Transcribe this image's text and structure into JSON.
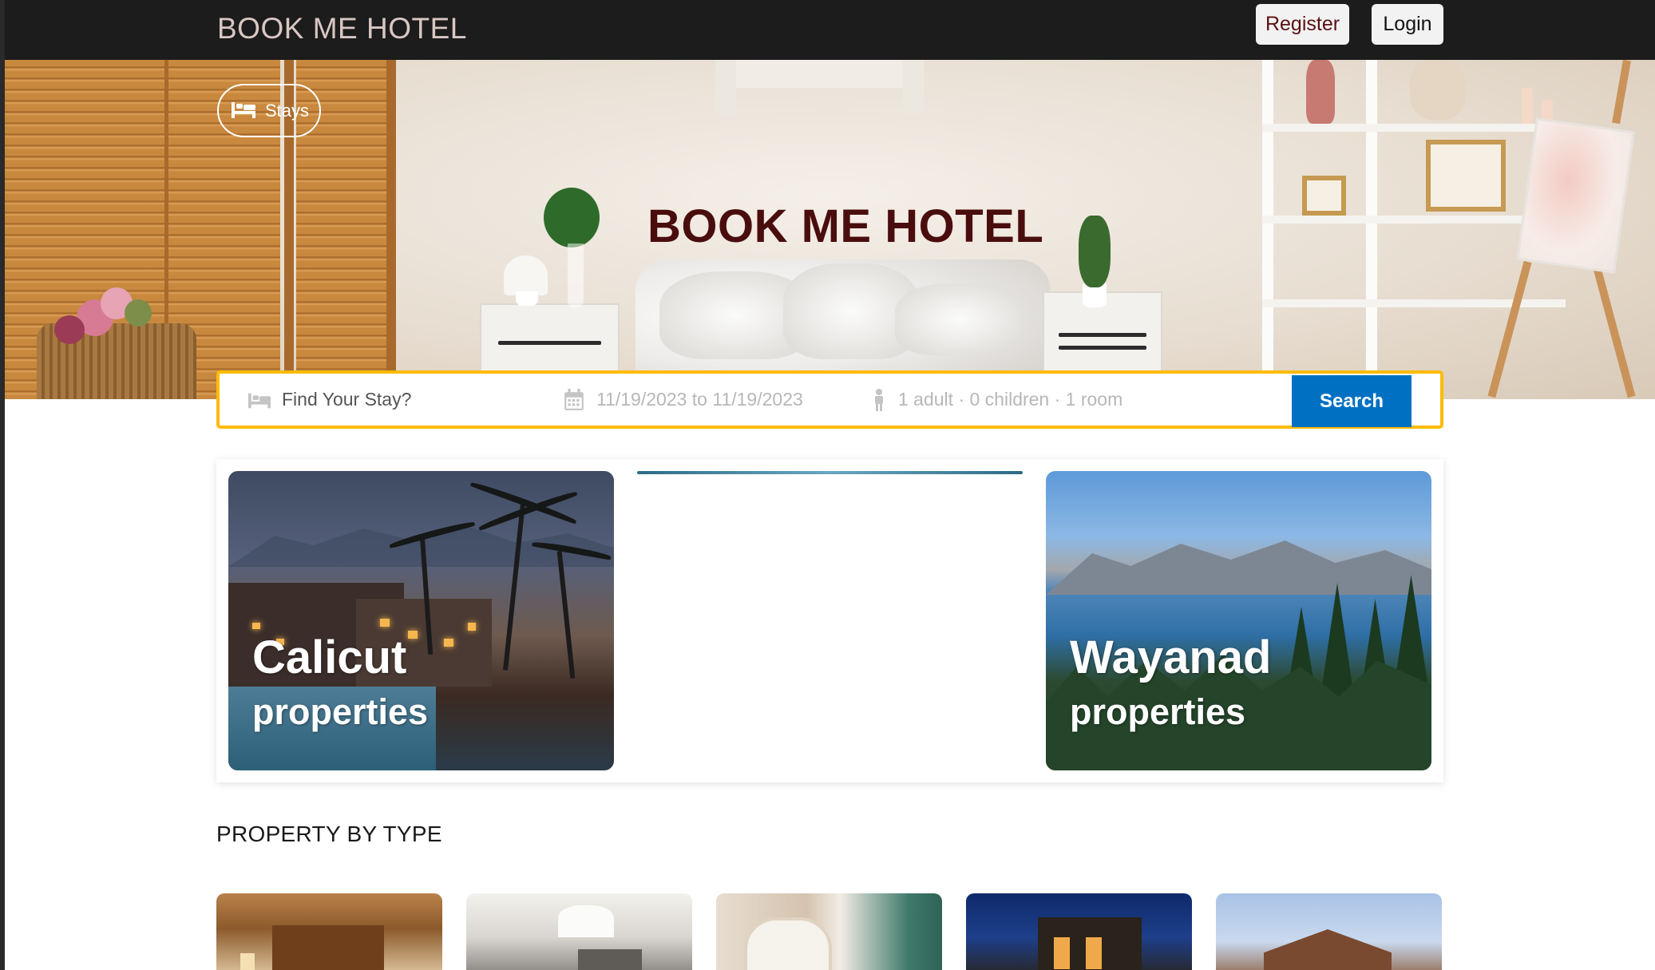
{
  "navbar": {
    "brand": "BOOK ME HOTEL",
    "register_label": "Register",
    "login_label": "Login"
  },
  "hero": {
    "stays_label": "Stays",
    "title": "BOOK ME HOTEL"
  },
  "search": {
    "placeholder": "Find Your Stay?",
    "dates": "11/19/2023 to 11/19/2023",
    "guests": "1 adult · 0 children · 1 room",
    "button_label": "Search"
  },
  "featured": [
    {
      "title": "Calicut",
      "subtitle": "properties"
    },
    {
      "title": "",
      "subtitle": ""
    },
    {
      "title": "Wayanad",
      "subtitle": "properties"
    }
  ],
  "property_type": {
    "heading": "PROPERTY BY TYPE"
  },
  "colors": {
    "navbar_bg": "#1c1c1c",
    "search_border": "#febb02",
    "search_button": "#0071c2",
    "hero_title": "#4a0d0d"
  },
  "icons": {
    "stays": "bed-icon",
    "where": "bed-icon",
    "dates": "calendar-icon",
    "guests": "person-icon"
  }
}
